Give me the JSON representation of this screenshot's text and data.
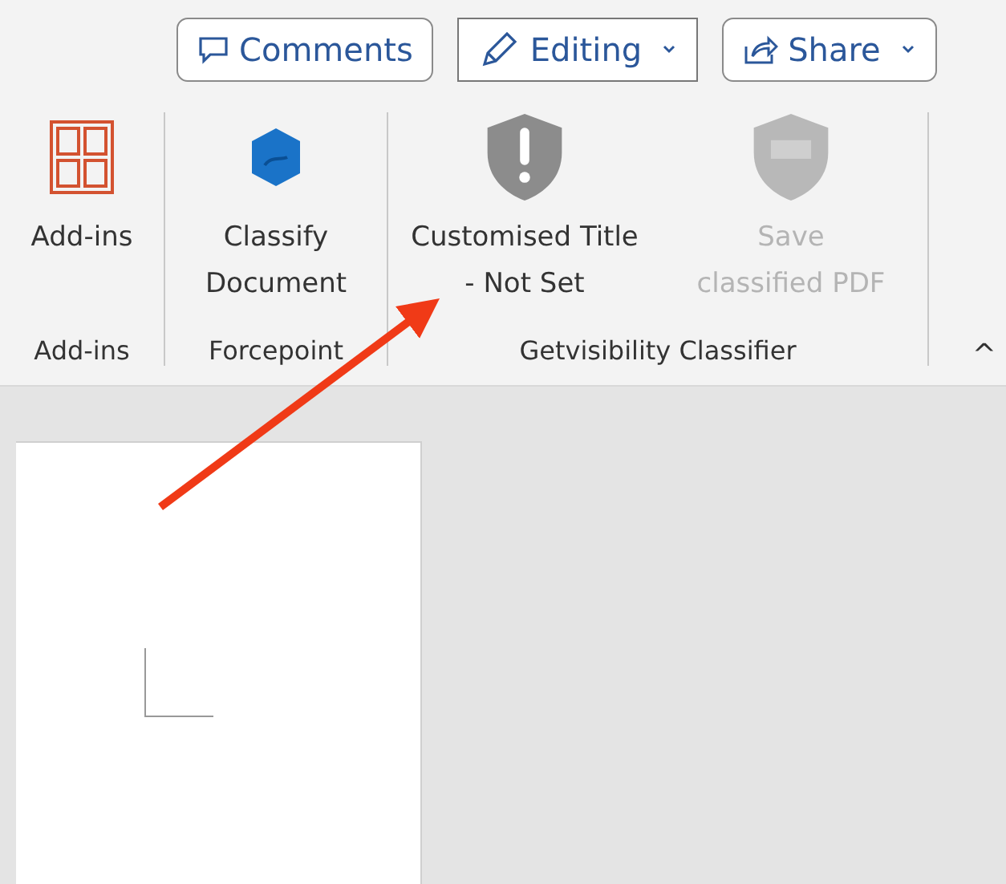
{
  "top_buttons": [
    {
      "kind": "comments",
      "label": "Comments",
      "dropdown": false
    },
    {
      "kind": "editing",
      "label": "Editing",
      "dropdown": true
    },
    {
      "kind": "share",
      "label": "Share",
      "dropdown": true
    }
  ],
  "ribbon": {
    "groups": [
      {
        "label": "Add-ins",
        "commands": [
          {
            "lines": [
              "Add-ins"
            ],
            "disabled": false
          }
        ]
      },
      {
        "label": "Forcepoint",
        "commands": [
          {
            "lines": [
              "Classify",
              "Document"
            ],
            "disabled": false
          }
        ]
      },
      {
        "label": "Getvisibility Classifier",
        "commands": [
          {
            "lines": [
              "Customised Title",
              "- Not Set"
            ],
            "disabled": false
          },
          {
            "lines": [
              "Save",
              "classified PDF"
            ],
            "disabled": true
          }
        ]
      }
    ],
    "collapse": "^"
  }
}
